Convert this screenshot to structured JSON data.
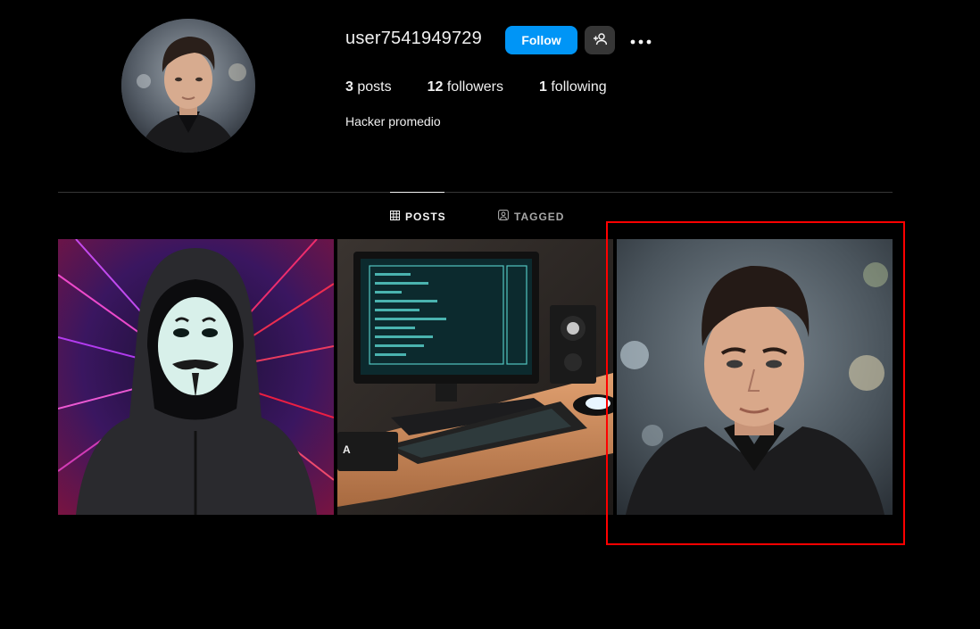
{
  "profile": {
    "username": "user7541949729",
    "follow_label": "Follow",
    "suggest_icon": "add-person-icon",
    "more_icon": "more-options-icon",
    "bio": "Hacker promedio"
  },
  "stats": {
    "posts_count": "3",
    "posts_label": "posts",
    "followers_count": "12",
    "followers_label": "followers",
    "following_count": "1",
    "following_label": "following"
  },
  "tabs": [
    {
      "label": "POSTS",
      "icon": "grid-icon",
      "active": true
    },
    {
      "label": "TAGGED",
      "icon": "tag-person-icon",
      "active": false
    }
  ],
  "posts": [
    {
      "subject": "hooded figure with mask"
    },
    {
      "subject": "computer desk setup"
    },
    {
      "subject": "portrait of young man"
    }
  ],
  "colors": {
    "background": "#000000",
    "accent": "#0095f6",
    "highlight": "#ff0000",
    "secondary_button": "#363636"
  }
}
